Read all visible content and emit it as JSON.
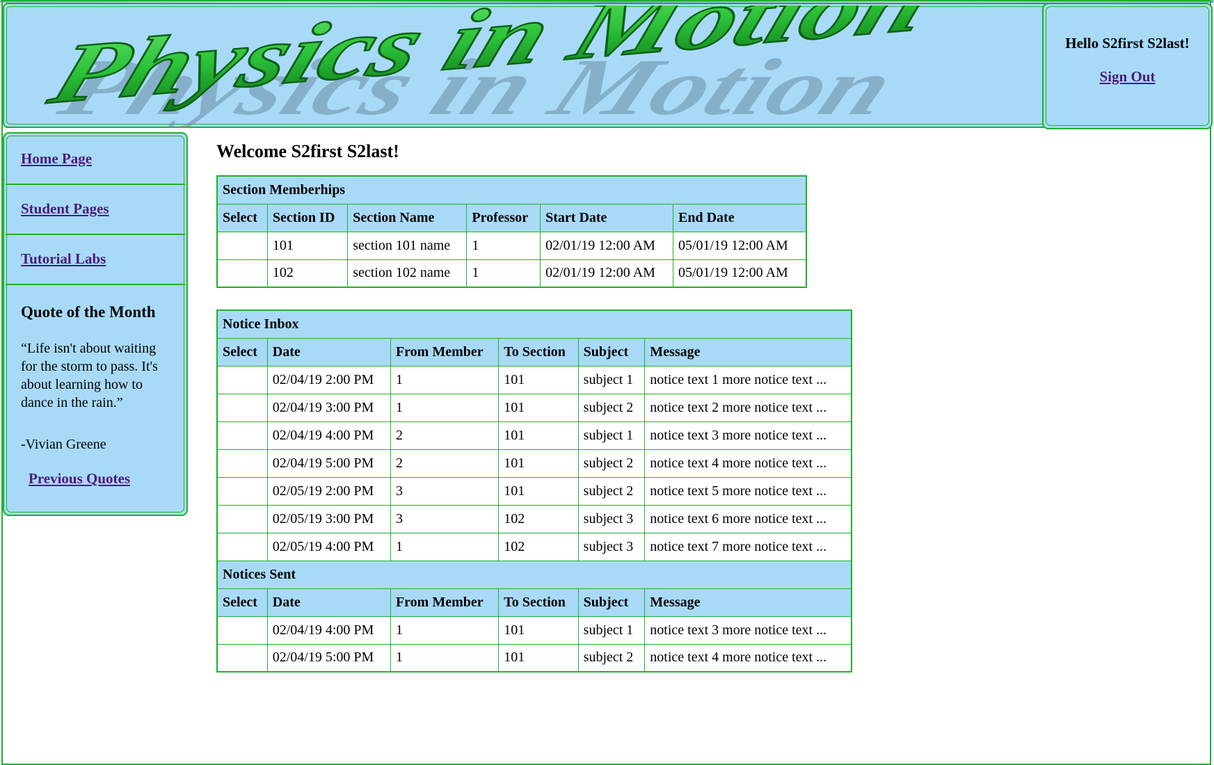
{
  "header": {
    "banner_text": "Physics in Motion",
    "greeting": "Hello S2first S2last!",
    "signout_label": "Sign Out"
  },
  "sidebar": {
    "items": [
      {
        "label": "Home Page"
      },
      {
        "label": "Student Pages"
      },
      {
        "label": "Tutorial Labs"
      }
    ],
    "quote": {
      "title": "Quote of the Month",
      "text": "“Life isn't about waiting for the storm to pass. It's about learning how to dance in the rain.”",
      "author": "-Vivian Greene",
      "previous_label": "Previous Quotes"
    }
  },
  "main": {
    "welcome": "Welcome S2first S2last!",
    "memberships": {
      "title": "Section Memberhips",
      "columns": [
        "Select",
        "Section ID",
        "Section Name",
        "Professor",
        "Start Date",
        "End Date"
      ],
      "rows": [
        [
          "",
          "101",
          "section 101 name",
          "1",
          "02/01/19 12:00 AM",
          "05/01/19 12:00 AM"
        ],
        [
          "",
          "102",
          "section 102 name",
          "1",
          "02/01/19 12:00 AM",
          "05/01/19 12:00 AM"
        ]
      ]
    },
    "inbox": {
      "title": "Notice Inbox",
      "columns": [
        "Select",
        "Date",
        "From Member",
        "To Section",
        "Subject",
        "Message"
      ],
      "rows": [
        [
          "",
          "02/04/19 2:00 PM",
          "1",
          "101",
          "subject 1",
          "notice text 1 more notice text ..."
        ],
        [
          "",
          "02/04/19 3:00 PM",
          "1",
          "101",
          "subject 2",
          "notice text 2 more notice text ..."
        ],
        [
          "",
          "02/04/19 4:00 PM",
          "2",
          "101",
          "subject 1",
          "notice text 3 more notice text ..."
        ],
        [
          "",
          "02/04/19 5:00 PM",
          "2",
          "101",
          "subject 2",
          "notice text 4 more notice text ..."
        ],
        [
          "",
          "02/05/19 2:00 PM",
          "3",
          "101",
          "subject 2",
          "notice text 5 more notice text ..."
        ],
        [
          "",
          "02/05/19 3:00 PM",
          "3",
          "102",
          "subject 3",
          "notice text 6 more notice text ..."
        ],
        [
          "",
          "02/05/19 4:00 PM",
          "1",
          "102",
          "subject 3",
          "notice text 7 more notice text ..."
        ]
      ]
    },
    "sent": {
      "title": "Notices Sent",
      "columns": [
        "Select",
        "Date",
        "From Member",
        "To Section",
        "Subject",
        "Message"
      ],
      "rows": [
        [
          "",
          "02/04/19 4:00 PM",
          "1",
          "101",
          "subject 1",
          "notice text 3 more notice text ..."
        ],
        [
          "",
          "02/04/19 5:00 PM",
          "1",
          "101",
          "subject 2",
          "notice text 4 more notice text ..."
        ]
      ]
    }
  },
  "colors": {
    "panel_bg": "#a8daf8",
    "border_green": "#1fb12c",
    "link_purple": "#4b1a7a",
    "banner_green": "#2fc23a"
  }
}
